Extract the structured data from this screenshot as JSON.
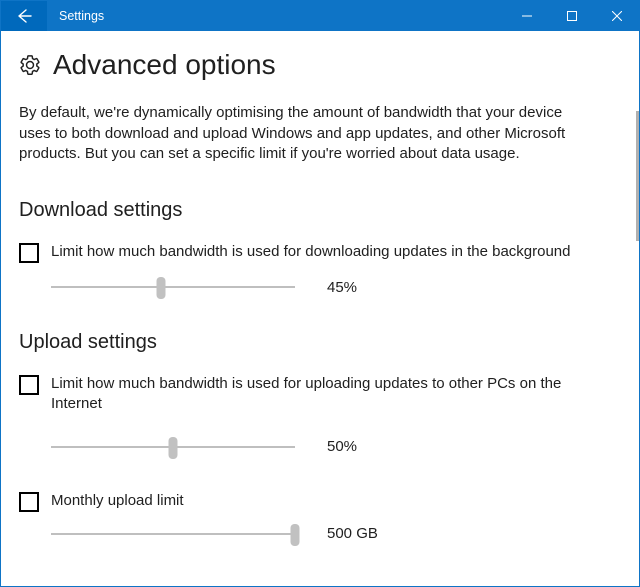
{
  "window": {
    "title": "Settings"
  },
  "page": {
    "heading": "Advanced options",
    "description": "By default, we're dynamically optimising the amount of bandwidth that your device uses to both download and upload Windows and app updates, and other Microsoft products. But you can set a specific limit if you're worried about data usage."
  },
  "download": {
    "heading": "Download settings",
    "limit_label": "Limit how much bandwidth is used for downloading updates in the background",
    "limit_checked": false,
    "slider_percent": 45,
    "slider_display": "45%"
  },
  "upload": {
    "heading": "Upload settings",
    "limit_label": "Limit how much bandwidth is used for uploading updates to other PCs on the Internet",
    "limit_checked": false,
    "slider_percent": 50,
    "slider_display": "50%",
    "monthly_label": "Monthly upload limit",
    "monthly_checked": false,
    "monthly_slider_percent": 100,
    "monthly_display": "500 GB"
  },
  "colors": {
    "accent": "#0e74c6"
  }
}
